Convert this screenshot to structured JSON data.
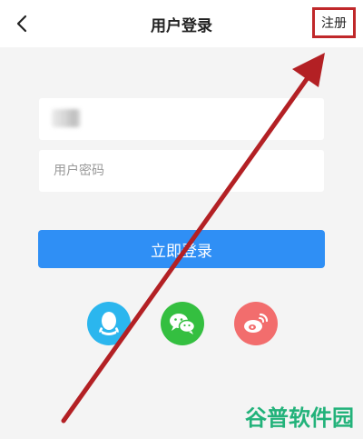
{
  "header": {
    "title": "用户登录",
    "register_label": "注册",
    "back_icon": "chevron-left-icon"
  },
  "form": {
    "username_value": "",
    "username_placeholder": "",
    "password_placeholder": "用户密码",
    "login_label": "立即登录"
  },
  "social": {
    "icons": [
      "qq-icon",
      "wechat-icon",
      "weibo-icon"
    ],
    "colors": {
      "qq": "#2bb6ee",
      "wechat": "#34bf40",
      "weibo": "#f26d6d"
    }
  },
  "annotation": {
    "arrow_color": "#b32024",
    "highlight_color": "#c0282a"
  },
  "watermark": {
    "text": "谷普软件园",
    "color": "#22b27a"
  },
  "colors": {
    "background": "#f4f4f4",
    "primary_button": "#2f8ff5"
  }
}
